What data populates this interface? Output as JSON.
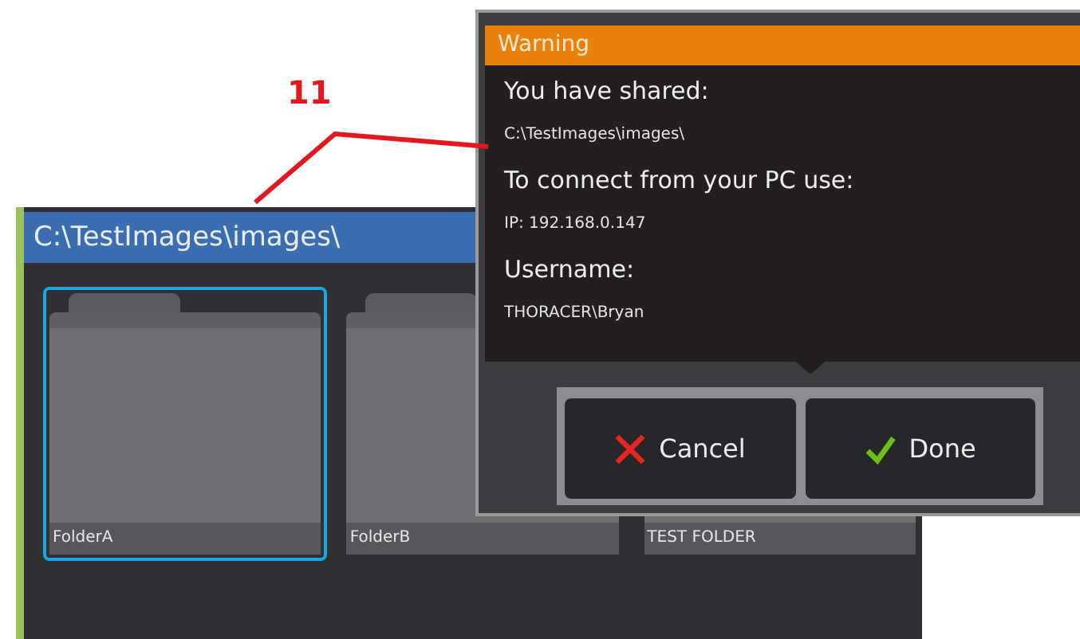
{
  "callout": {
    "label": "11"
  },
  "window": {
    "title": "C:\\TestImages\\images\\"
  },
  "folders": [
    {
      "label": "FolderA",
      "selected": true
    },
    {
      "label": "FolderB",
      "selected": false
    },
    {
      "label": "TEST FOLDER",
      "selected": false
    }
  ],
  "dialog": {
    "title": "Warning",
    "lines": [
      {
        "kind": "heading",
        "text": "You have shared:"
      },
      {
        "kind": "value",
        "text": "C:\\TestImages\\images\\"
      },
      {
        "kind": "heading",
        "text": "To connect from your PC use:"
      },
      {
        "kind": "value",
        "text": "IP: 192.168.0.147"
      },
      {
        "kind": "heading",
        "text": "Username:"
      },
      {
        "kind": "value",
        "text": "THORACER\\Bryan"
      }
    ],
    "buttons": [
      {
        "kind": "cancel",
        "label": "Cancel"
      },
      {
        "kind": "done",
        "label": "Done"
      }
    ]
  }
}
